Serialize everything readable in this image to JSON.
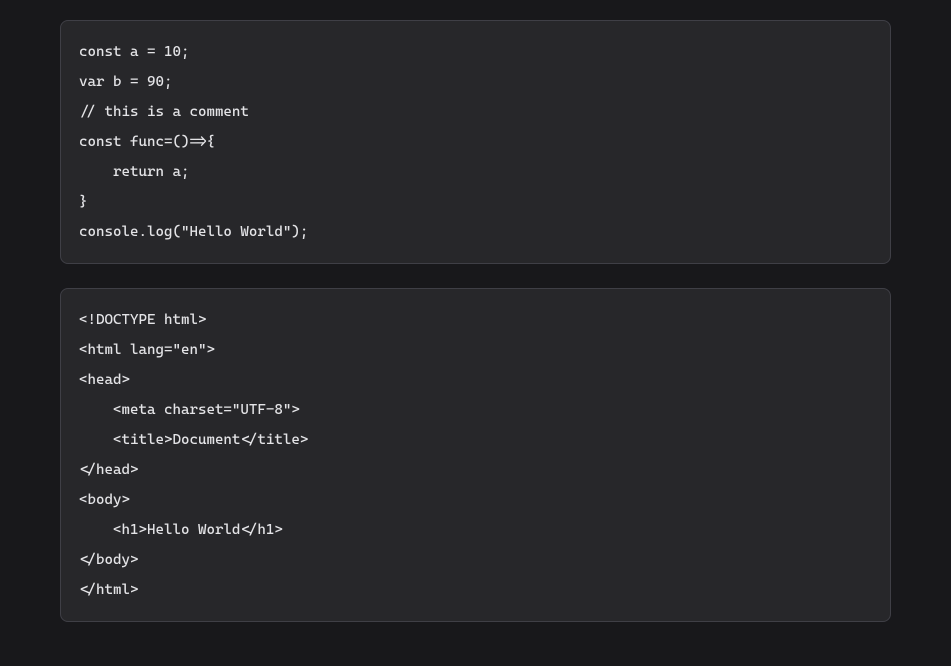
{
  "blocks": [
    {
      "language": "javascript",
      "code": "const a = 10;\nvar b = 90;\n// this is a comment\nconst func=()=>{\n    return a;\n}\nconsole.log(\"Hello World\");"
    },
    {
      "language": "html",
      "code": "<!DOCTYPE html>\n<html lang=\"en\">\n<head>\n    <meta charset=\"UTF-8\">\n    <title>Document</title>\n</head>\n<body>\n    <h1>Hello World</h1>\n</body>\n</html>"
    }
  ]
}
